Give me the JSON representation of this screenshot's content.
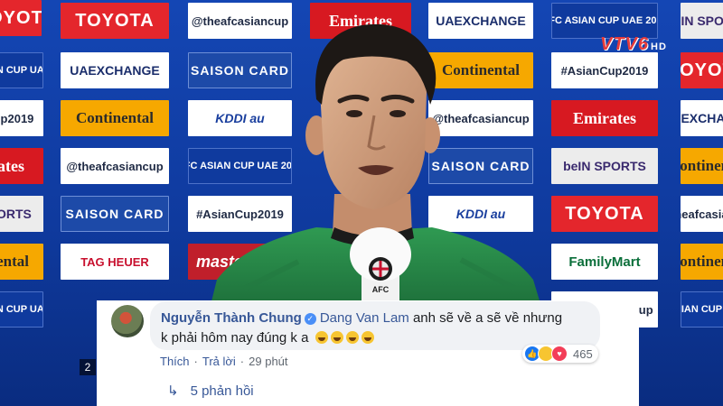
{
  "broadcaster_logo": {
    "text": "VTV6",
    "suffix": "HD"
  },
  "backdrop": {
    "sponsors": {
      "toyota": "TOYOTA",
      "afc_handle": "@theafcasiancup",
      "emirates": "Emirates",
      "uae_exchange": "UAEXCHANGE",
      "asian_cup": "AFC ASIAN CUP UAE 2019",
      "bein": "beIN SPORTS",
      "saison": "SAISON CARD",
      "continental": "Continental",
      "hashtag": "#AsianCup2019",
      "kddi": "KDDI au",
      "familymart": "FamilyMart",
      "tag_heuer": "TAG HEUER",
      "mastercard": "mastercard"
    }
  },
  "mic_flag": {
    "text": "AFC"
  },
  "overlay_number": "2",
  "comment": {
    "author": "Nguyễn Thành Chung",
    "verified_glyph": "✓",
    "mention": "Dang Van Lam",
    "text_line1": "anh sẽ về a sẽ về nhưng",
    "text_line2": "k phải hôm nay đúng k a",
    "emoji_count": 4,
    "reactions": {
      "icons": [
        "like-icon",
        "haha-icon",
        "love-icon"
      ],
      "count": "465"
    },
    "actions": {
      "like": "Thích",
      "reply": "Trả lời",
      "time": "29 phút",
      "separator": "·"
    },
    "replies": {
      "arrow": "↳",
      "label": "5 phản hồi"
    }
  },
  "colors": {
    "link": "#385898",
    "bubble": "#f0f2f5",
    "backdrop_blue": "#0f3a9e"
  }
}
